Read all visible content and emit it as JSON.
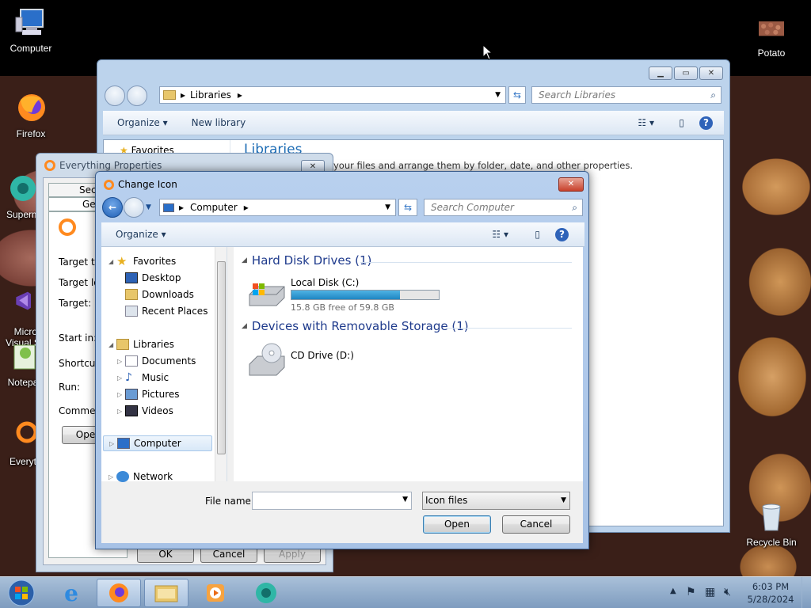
{
  "desktop": {
    "icons": [
      {
        "label": "Computer"
      },
      {
        "label": "Firefox"
      },
      {
        "label": "Superm"
      },
      {
        "label": "Micro\nVisual S"
      },
      {
        "label": "Notepa"
      },
      {
        "label": "Everyt"
      },
      {
        "label": "Potato"
      },
      {
        "label": "Recycle Bin"
      }
    ]
  },
  "libraries_window": {
    "breadcrumb": "Libraries",
    "search_placeholder": "Search Libraries",
    "toolbar": {
      "organize": "Organize",
      "new_library": "New library"
    },
    "nav_favorites": "Favorites",
    "heading": "Libraries",
    "description": "your files and arrange them by folder, date, and other properties."
  },
  "properties_window": {
    "title": "Everything Properties",
    "tabs": [
      "Securi",
      "Gene"
    ],
    "fields": [
      "Target ty",
      "Target lo",
      "Target:",
      "Start in:",
      "Shortcut",
      "Run:",
      "Commen"
    ],
    "open_button": "Ope",
    "buttons": {
      "ok": "OK",
      "cancel": "Cancel",
      "apply": "Apply"
    }
  },
  "dialog": {
    "title": "Change Icon",
    "breadcrumb": "Computer",
    "search_placeholder": "Search Computer",
    "toolbar": {
      "organize": "Organize"
    },
    "nav": {
      "favorites": "Favorites",
      "desktop": "Desktop",
      "downloads": "Downloads",
      "recent_places": "Recent Places",
      "libraries": "Libraries",
      "documents": "Documents",
      "music": "Music",
      "pictures": "Pictures",
      "videos": "Videos",
      "computer": "Computer",
      "network": "Network"
    },
    "groups": {
      "hdd": "Hard Disk Drives (1)",
      "removable": "Devices with Removable Storage (1)"
    },
    "drives": {
      "local_name": "Local Disk (C:)",
      "local_free": "15.8 GB free of 59.8 GB",
      "local_used_fraction": 0.736,
      "cd_name": "CD Drive (D:)"
    },
    "filename_label": "File name:",
    "filename_value": "",
    "filetype": "Icon files",
    "open": "Open",
    "cancel": "Cancel"
  },
  "taskbar": {
    "time": "6:03 PM",
    "date": "5/28/2024"
  }
}
